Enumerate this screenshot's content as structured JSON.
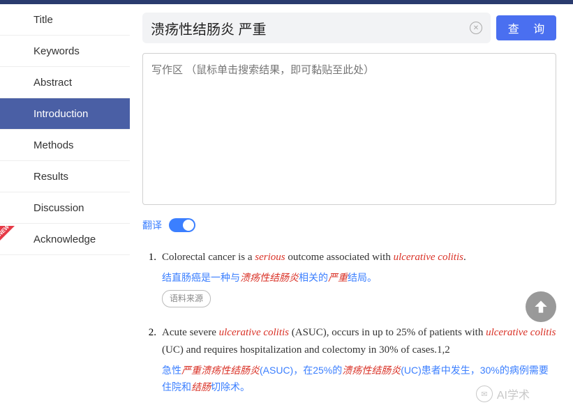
{
  "sidebar": {
    "items": [
      {
        "label": "Title"
      },
      {
        "label": "Keywords"
      },
      {
        "label": "Abstract"
      },
      {
        "label": "Introduction"
      },
      {
        "label": "Methods"
      },
      {
        "label": "Results"
      },
      {
        "label": "Discussion"
      },
      {
        "label": "Acknowledge"
      }
    ],
    "active_index": 3,
    "new_badge_index": 7,
    "new_badge_text": "NEW"
  },
  "search": {
    "value": "溃疡性结肠炎 严重",
    "query_button": "查 询"
  },
  "writing_area": {
    "placeholder": "写作区 （鼠标单击搜索结果，即可黏贴至此处）"
  },
  "translate": {
    "label": "翻译",
    "on": true
  },
  "results": [
    {
      "num": "1.",
      "en_segments": [
        {
          "t": "Colorectal cancer is a ",
          "hl": false
        },
        {
          "t": "serious",
          "hl": true
        },
        {
          "t": " outcome associated with ",
          "hl": false
        },
        {
          "t": "ulcerative colitis",
          "hl": true
        },
        {
          "t": ".",
          "hl": false
        }
      ],
      "zh_segments": [
        {
          "t": "结直肠癌是一种与",
          "hl": false
        },
        {
          "t": "溃疡性结肠炎",
          "hl": true
        },
        {
          "t": "相关的",
          "hl": false
        },
        {
          "t": "严重",
          "hl": true
        },
        {
          "t": "结局。",
          "hl": false
        }
      ],
      "source_label": "语料来源"
    },
    {
      "num": "2.",
      "en_segments": [
        {
          "t": "Acute severe ",
          "hl": false
        },
        {
          "t": "ulcerative colitis",
          "hl": true
        },
        {
          "t": " (ASUC), occurs in up to 25% of patients with ",
          "hl": false
        },
        {
          "t": "ulcerative colitis",
          "hl": true
        },
        {
          "t": " (UC) and requires hospitalization and colectomy in 30% of cases.1,2",
          "hl": false
        }
      ],
      "zh_segments": [
        {
          "t": "急性",
          "hl": false
        },
        {
          "t": "严重溃疡性结肠炎",
          "hl": true
        },
        {
          "t": "(ASUC)，在25%的",
          "hl": false
        },
        {
          "t": "溃疡性结肠炎",
          "hl": true
        },
        {
          "t": "(UC)患者中发生，30%的病例需要住院和",
          "hl": false
        },
        {
          "t": "结肠",
          "hl": true
        },
        {
          "t": "切除术。",
          "hl": false
        }
      ],
      "source_label": ""
    }
  ],
  "watermark": {
    "text": "AI学术"
  }
}
